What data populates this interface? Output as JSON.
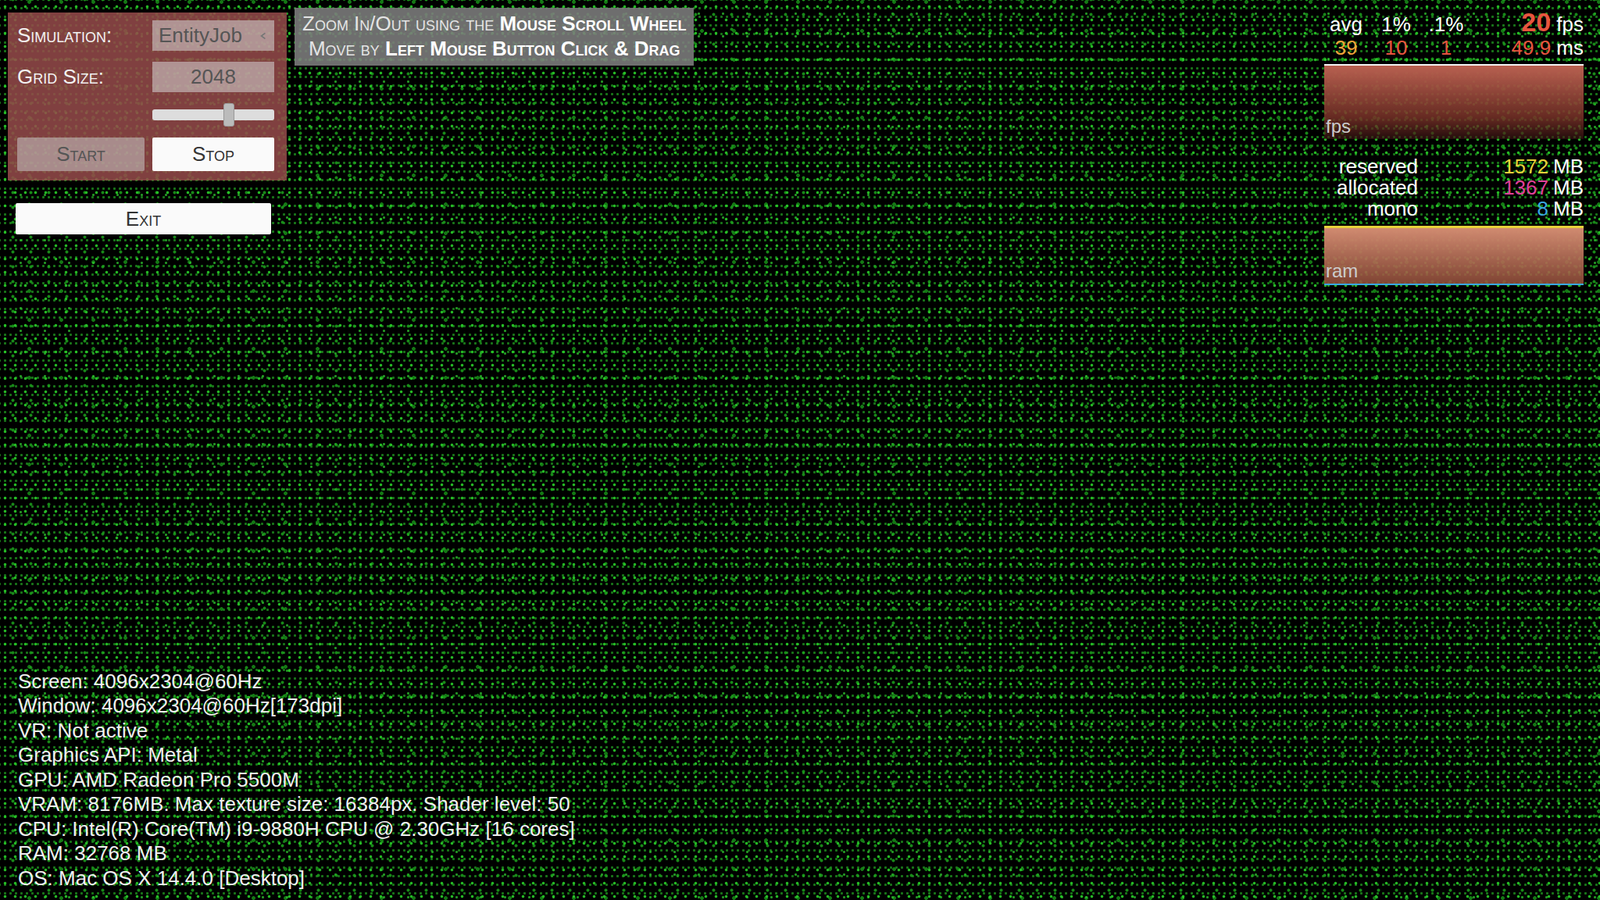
{
  "control_panel": {
    "simulation": {
      "label": "Simulation:",
      "value": "EntityJob"
    },
    "grid_size": {
      "label": "Grid Size:",
      "value": "2048",
      "slider_level": 0.63
    },
    "buttons": [
      {
        "label": "Start",
        "disabled": true
      },
      {
        "label": "Stop",
        "disabled": false
      }
    ]
  },
  "exit_button": {
    "label": "Exit"
  },
  "instructions": [
    [
      {
        "text": "Zoom In/Out using the ",
        "strong": false
      },
      {
        "text": "Mouse Scroll Wheel",
        "strong": true
      }
    ],
    [
      {
        "text": "Move by ",
        "strong": false
      },
      {
        "text": "Left Mouse Button Click & Drag",
        "strong": true
      }
    ]
  ],
  "stats": {
    "headers": [
      "avg",
      "1%",
      ".1%"
    ],
    "fps": "20",
    "fps_unit": "fps",
    "values": [
      {
        "text": "39",
        "color": "#f0a53a"
      },
      {
        "text": "10",
        "color": "#e8553f"
      },
      {
        "text": "1",
        "color": "#e8553f"
      }
    ],
    "ms": "49.9",
    "ms_unit": "ms",
    "fps_graph_label": "fps",
    "memory": [
      {
        "label": "reserved",
        "value": "1572",
        "unit": "MB",
        "color": "#e8d23a"
      },
      {
        "label": "allocated",
        "value": "1367",
        "unit": "MB",
        "color": "#e0409a"
      },
      {
        "label": "mono",
        "value": "8",
        "unit": "MB",
        "color": "#3aa8e0"
      }
    ],
    "ram_graph_label": "ram"
  },
  "system_info": [
    "Screen: 4096x2304@60Hz",
    "Window: 4096x2304@60Hz[173dpi]",
    "VR: Not active",
    "Graphics API: Metal",
    "GPU: AMD Radeon Pro 5500M",
    "VRAM: 8176MB. Max texture size: 16384px. Shader level: 50",
    "CPU: Intel(R) Core(TM) i9-9880H CPU @ 2.30GHz [16 cores]",
    "RAM: 32768 MB",
    "OS: Mac OS X 14.4.0 [Desktop]"
  ]
}
